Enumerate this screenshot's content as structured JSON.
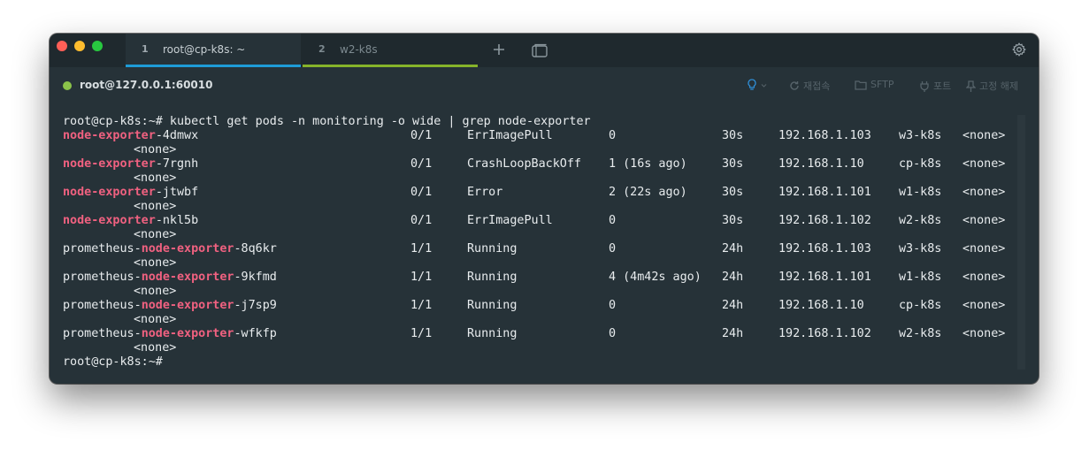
{
  "tabs": [
    {
      "index": "1",
      "label": "root@cp-k8s: ~"
    },
    {
      "index": "2",
      "label": "w2-k8s"
    }
  ],
  "session": {
    "label": "root@127.0.0.1:60010",
    "reconnect_label": "재접속",
    "sftp_label": "SFTP",
    "port_label": "포트",
    "unpin_label": "고정 해제",
    "status_color": "#8bc34a"
  },
  "terminal": {
    "command_line": "root@cp-k8s:~# kubectl get pods -n monitoring -o wide | grep node-exporter",
    "highlight_term": "node-exporter",
    "rows": [
      {
        "prefix": "",
        "match": "node-exporter",
        "suffix": "-4dmwx",
        "ready": "0/1",
        "status": "ErrImagePull",
        "restarts": "0",
        "age": "30s",
        "ip": "192.168.1.103",
        "node": "w3-k8s",
        "nominated": "<none>",
        "gates": "<none>"
      },
      {
        "prefix": "",
        "match": "node-exporter",
        "suffix": "-7rgnh",
        "ready": "0/1",
        "status": "CrashLoopBackOff",
        "restarts": "1 (16s ago)",
        "age": "30s",
        "ip": "192.168.1.10",
        "node": "cp-k8s",
        "nominated": "<none>",
        "gates": "<none>"
      },
      {
        "prefix": "",
        "match": "node-exporter",
        "suffix": "-jtwbf",
        "ready": "0/1",
        "status": "Error",
        "restarts": "2 (22s ago)",
        "age": "30s",
        "ip": "192.168.1.101",
        "node": "w1-k8s",
        "nominated": "<none>",
        "gates": "<none>"
      },
      {
        "prefix": "",
        "match": "node-exporter",
        "suffix": "-nkl5b",
        "ready": "0/1",
        "status": "ErrImagePull",
        "restarts": "0",
        "age": "30s",
        "ip": "192.168.1.102",
        "node": "w2-k8s",
        "nominated": "<none>",
        "gates": "<none>"
      },
      {
        "prefix": "prometheus-",
        "match": "node-exporter",
        "suffix": "-8q6kr",
        "ready": "1/1",
        "status": "Running",
        "restarts": "0",
        "age": "24h",
        "ip": "192.168.1.103",
        "node": "w3-k8s",
        "nominated": "<none>",
        "gates": "<none>"
      },
      {
        "prefix": "prometheus-",
        "match": "node-exporter",
        "suffix": "-9kfmd",
        "ready": "1/1",
        "status": "Running",
        "restarts": "4 (4m42s ago)",
        "age": "24h",
        "ip": "192.168.1.101",
        "node": "w1-k8s",
        "nominated": "<none>",
        "gates": "<none>"
      },
      {
        "prefix": "prometheus-",
        "match": "node-exporter",
        "suffix": "-j7sp9",
        "ready": "1/1",
        "status": "Running",
        "restarts": "0",
        "age": "24h",
        "ip": "192.168.1.10",
        "node": "cp-k8s",
        "nominated": "<none>",
        "gates": "<none>"
      },
      {
        "prefix": "prometheus-",
        "match": "node-exporter",
        "suffix": "-wfkfp",
        "ready": "1/1",
        "status": "Running",
        "restarts": "0",
        "age": "24h",
        "ip": "192.168.1.102",
        "node": "w2-k8s",
        "nominated": "<none>",
        "gates": "<none>"
      }
    ],
    "prompt": "root@cp-k8s:~#"
  },
  "colors": {
    "highlight": "#f06180",
    "tab1_accent": "#1e9bd7",
    "tab2_accent": "#86b32a"
  },
  "icons": [
    "close-button",
    "minimize-button",
    "maximize-button",
    "plus-icon",
    "windows-icon",
    "gear-icon",
    "lightbulb-icon",
    "reconnect-icon",
    "folder-icon",
    "plug-icon",
    "pin-icon"
  ]
}
